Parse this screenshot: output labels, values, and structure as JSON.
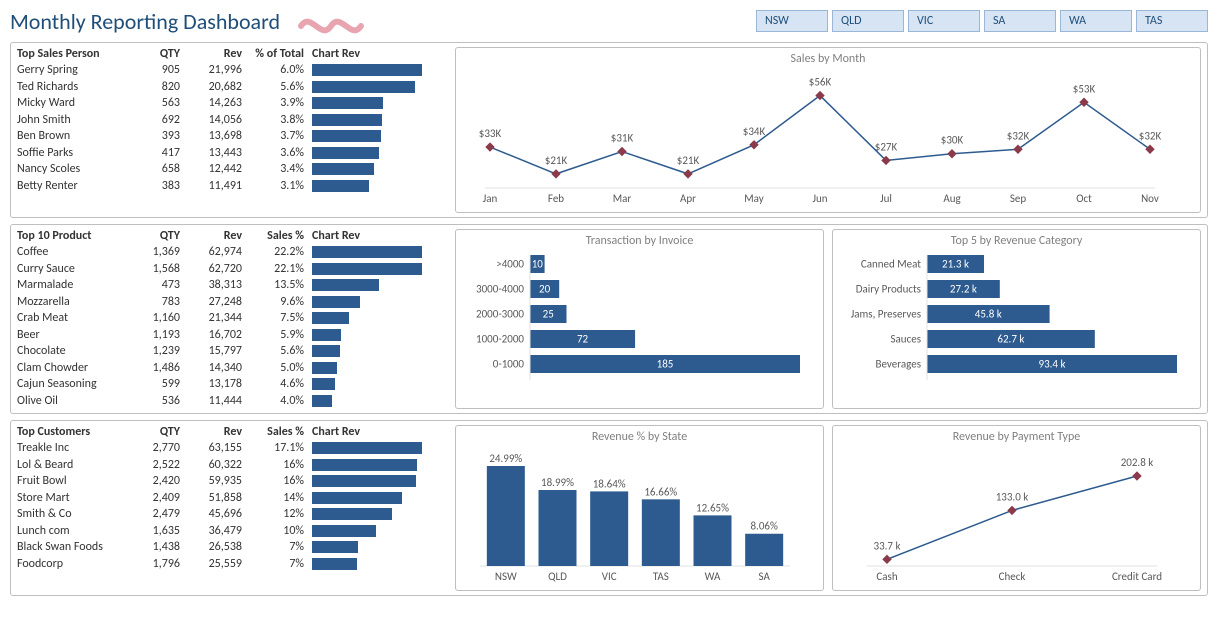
{
  "title": "Monthly Reporting Dashboard",
  "states": [
    "NSW",
    "QLD",
    "VIC",
    "SA",
    "WA",
    "TAS"
  ],
  "tables": {
    "salesperson": {
      "headers": {
        "name": "Top Sales Person",
        "qty": "QTY",
        "rev": "Rev",
        "pct": "% of Total",
        "chart": "Chart Rev"
      },
      "rows": [
        {
          "name": "Gerry Spring",
          "qty": "905",
          "rev": "21,996",
          "pct": "6.0%",
          "v": 21996
        },
        {
          "name": "Ted Richards",
          "qty": "820",
          "rev": "20,682",
          "pct": "5.6%",
          "v": 20682
        },
        {
          "name": "Micky Ward",
          "qty": "563",
          "rev": "14,263",
          "pct": "3.9%",
          "v": 14263
        },
        {
          "name": "John Smith",
          "qty": "692",
          "rev": "14,056",
          "pct": "3.8%",
          "v": 14056
        },
        {
          "name": "Ben Brown",
          "qty": "393",
          "rev": "13,698",
          "pct": "3.7%",
          "v": 13698
        },
        {
          "name": "Soffie Parks",
          "qty": "417",
          "rev": "13,443",
          "pct": "3.6%",
          "v": 13443
        },
        {
          "name": "Nancy Scoles",
          "qty": "658",
          "rev": "12,442",
          "pct": "3.4%",
          "v": 12442
        },
        {
          "name": "Betty Renter",
          "qty": "383",
          "rev": "11,491",
          "pct": "3.1%",
          "v": 11491
        }
      ]
    },
    "products": {
      "headers": {
        "name": "Top 10 Product",
        "qty": "QTY",
        "rev": "Rev",
        "pct": "Sales %",
        "chart": "Chart Rev"
      },
      "rows": [
        {
          "name": "Coffee",
          "qty": "1,369",
          "rev": "62,974",
          "pct": "22.2%",
          "v": 62974
        },
        {
          "name": "Curry Sauce",
          "qty": "1,568",
          "rev": "62,720",
          "pct": "22.1%",
          "v": 62720
        },
        {
          "name": "Marmalade",
          "qty": "473",
          "rev": "38,313",
          "pct": "13.5%",
          "v": 38313
        },
        {
          "name": "Mozzarella",
          "qty": "783",
          "rev": "27,248",
          "pct": "9.6%",
          "v": 27248
        },
        {
          "name": "Crab Meat",
          "qty": "1,160",
          "rev": "21,344",
          "pct": "7.5%",
          "v": 21344
        },
        {
          "name": "Beer",
          "qty": "1,193",
          "rev": "16,702",
          "pct": "5.9%",
          "v": 16702
        },
        {
          "name": "Chocolate",
          "qty": "1,239",
          "rev": "15,797",
          "pct": "5.6%",
          "v": 15797
        },
        {
          "name": "Clam Chowder",
          "qty": "1,486",
          "rev": "14,340",
          "pct": "5.0%",
          "v": 14340
        },
        {
          "name": "Cajun Seasoning",
          "qty": "599",
          "rev": "13,178",
          "pct": "4.6%",
          "v": 13178
        },
        {
          "name": "Olive Oil",
          "qty": "536",
          "rev": "11,444",
          "pct": "4.0%",
          "v": 11444
        }
      ]
    },
    "customers": {
      "headers": {
        "name": "Top Customers",
        "qty": "QTY",
        "rev": "Rev",
        "pct": "Sales %",
        "chart": "Chart Rev"
      },
      "rows": [
        {
          "name": "Treakle Inc",
          "qty": "2,770",
          "rev": "63,155",
          "pct": "17.1%",
          "v": 63155
        },
        {
          "name": "Lol & Beard",
          "qty": "2,522",
          "rev": "60,322",
          "pct": "16%",
          "v": 60322
        },
        {
          "name": "Fruit Bowl",
          "qty": "2,420",
          "rev": "59,935",
          "pct": "16%",
          "v": 59935
        },
        {
          "name": "Store Mart",
          "qty": "2,409",
          "rev": "51,858",
          "pct": "14%",
          "v": 51858
        },
        {
          "name": "Smith & Co",
          "qty": "2,479",
          "rev": "45,696",
          "pct": "12%",
          "v": 45696
        },
        {
          "name": "Lunch com",
          "qty": "1,635",
          "rev": "36,479",
          "pct": "10%",
          "v": 36479
        },
        {
          "name": "Black Swan Foods",
          "qty": "1,438",
          "rev": "26,538",
          "pct": "7%",
          "v": 26538
        },
        {
          "name": "Foodcorp",
          "qty": "1,796",
          "rev": "25,559",
          "pct": "7%",
          "v": 25559
        }
      ]
    }
  },
  "chart_data": [
    {
      "id": "sales_by_month",
      "type": "line",
      "title": "Sales by Month",
      "categories": [
        "Jan",
        "Feb",
        "Mar",
        "Apr",
        "May",
        "Jun",
        "Jul",
        "Aug",
        "Sep",
        "Oct",
        "Nov"
      ],
      "labels": [
        "$33K",
        "$21K",
        "$31K",
        "$21K",
        "$34K",
        "$56K",
        "$27K",
        "$30K",
        "$32K",
        "$53K",
        "$32K"
      ],
      "values": [
        33,
        21,
        31,
        21,
        34,
        56,
        27,
        30,
        32,
        53,
        32
      ]
    },
    {
      "id": "trans_by_invoice",
      "type": "bar_h",
      "title": "Transaction by Invoice",
      "categories": [
        ">4000",
        "3000-4000",
        "2000-3000",
        "1000-2000",
        "0-1000"
      ],
      "values": [
        10,
        20,
        25,
        72,
        185
      ]
    },
    {
      "id": "top5_category",
      "type": "bar_h",
      "title": "Top 5 by Revenue Category",
      "categories": [
        "Canned Meat",
        "Dairy Products",
        "Jams, Preserves",
        "Sauces",
        "Beverages"
      ],
      "labels": [
        "21.3 k",
        "27.2 k",
        "45.8 k",
        "62.7 k",
        "93.4 k"
      ],
      "values": [
        21.3,
        27.2,
        45.8,
        62.7,
        93.4
      ]
    },
    {
      "id": "rev_by_state",
      "type": "bar",
      "title": "Revenue % by State",
      "categories": [
        "NSW",
        "QLD",
        "VIC",
        "TAS",
        "WA",
        "SA"
      ],
      "labels": [
        "24.99%",
        "18.99%",
        "18.64%",
        "16.66%",
        "12.65%",
        "8.06%"
      ],
      "values": [
        24.99,
        18.99,
        18.64,
        16.66,
        12.65,
        8.06
      ]
    },
    {
      "id": "rev_by_payment",
      "type": "line",
      "title": "Revenue by Payment Type",
      "categories": [
        "Cash",
        "Check",
        "Credit Card"
      ],
      "labels": [
        "33.7 k",
        "133.0 k",
        "202.8 k"
      ],
      "values": [
        33.7,
        133.0,
        202.8
      ]
    }
  ]
}
